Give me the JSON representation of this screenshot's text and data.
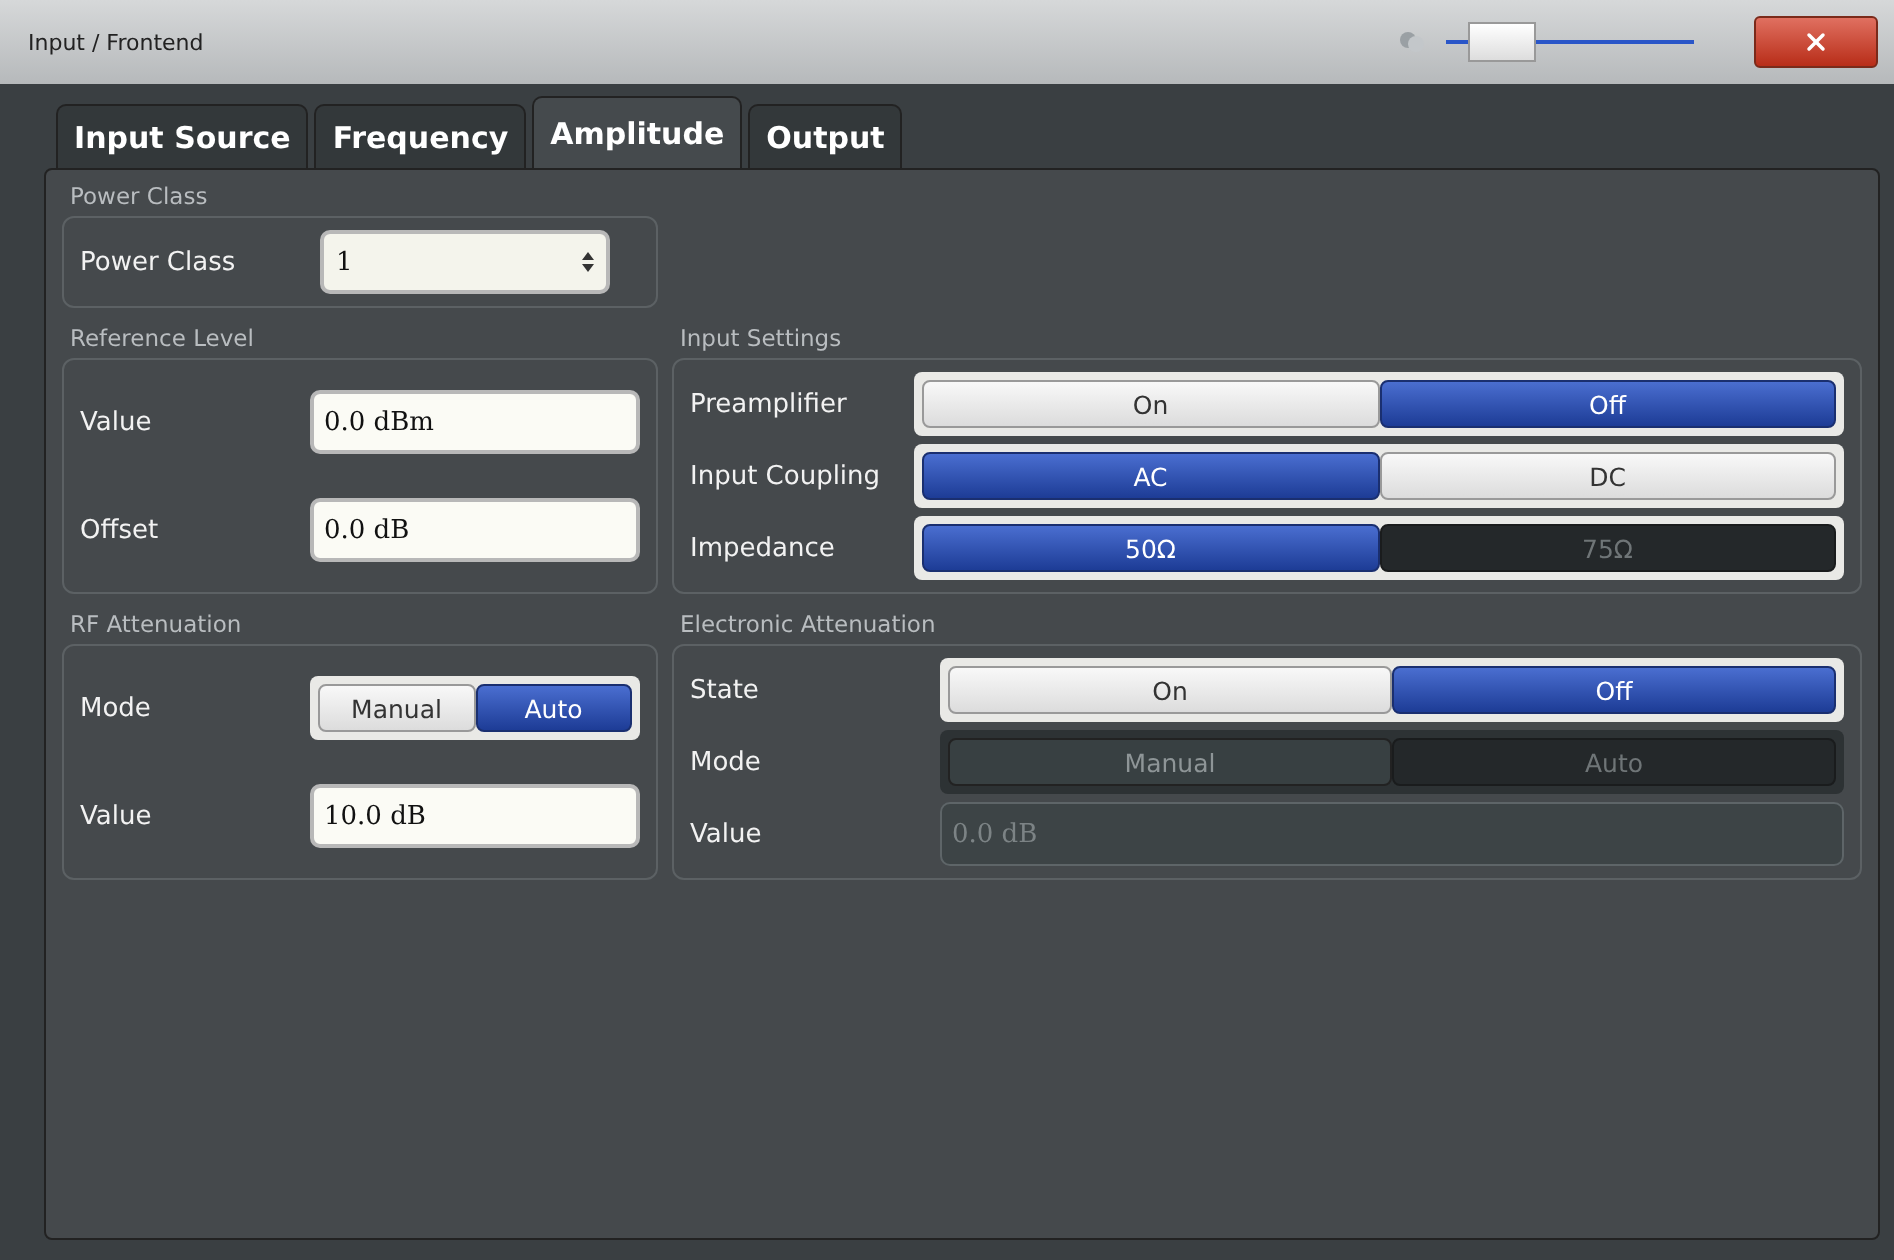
{
  "window": {
    "title": "Input / Frontend"
  },
  "transparency": {
    "level": 0.12
  },
  "tabs": [
    {
      "label": "Input Source",
      "selected": false
    },
    {
      "label": "Frequency",
      "selected": false
    },
    {
      "label": "Amplitude",
      "selected": true
    },
    {
      "label": "Output",
      "selected": false
    }
  ],
  "sections": [
    {
      "title": "Power Class",
      "rows": [
        {
          "kind": "select",
          "label": "Power Class",
          "value": "1"
        }
      ]
    },
    {
      "title": "Reference Level",
      "rows": [
        {
          "kind": "field",
          "label": "Value",
          "value": "0.0 dBm"
        },
        {
          "kind": "field",
          "label": "Offset",
          "value": "0.0 dB"
        }
      ]
    },
    {
      "title": "Input Settings",
      "rows": [
        {
          "kind": "toggle",
          "label": "Preamplifier",
          "options": [
            {
              "label": "On",
              "selected": false
            },
            {
              "label": "Off",
              "selected": true
            }
          ]
        },
        {
          "kind": "toggle",
          "label": "Input Coupling",
          "options": [
            {
              "label": "AC",
              "selected": true
            },
            {
              "label": "DC",
              "selected": false
            }
          ]
        },
        {
          "kind": "toggle",
          "label": "Impedance",
          "options": [
            {
              "label": "50Ω",
              "selected": true
            },
            {
              "label": "75Ω",
              "selected": false,
              "disabled": true
            }
          ]
        }
      ]
    },
    {
      "title": "RF Attenuation",
      "rows": [
        {
          "kind": "toggle",
          "label": "Mode",
          "options": [
            {
              "label": "Manual",
              "selected": false
            },
            {
              "label": "Auto",
              "selected": true
            }
          ]
        },
        {
          "kind": "field",
          "label": "Value",
          "value": "10.0 dB"
        }
      ]
    },
    {
      "title": "Electronic Attenuation",
      "rows": [
        {
          "kind": "toggle",
          "label": "State",
          "options": [
            {
              "label": "On",
              "selected": false
            },
            {
              "label": "Off",
              "selected": true
            }
          ]
        },
        {
          "kind": "toggle",
          "label": "Mode",
          "disabled": true,
          "options": [
            {
              "label": "Manual",
              "selected": true,
              "disabled": true
            },
            {
              "label": "Auto",
              "selected": false,
              "disabled": true
            }
          ]
        },
        {
          "kind": "field",
          "label": "Value",
          "value": "0.0 dB",
          "disabled": true
        }
      ]
    }
  ]
}
